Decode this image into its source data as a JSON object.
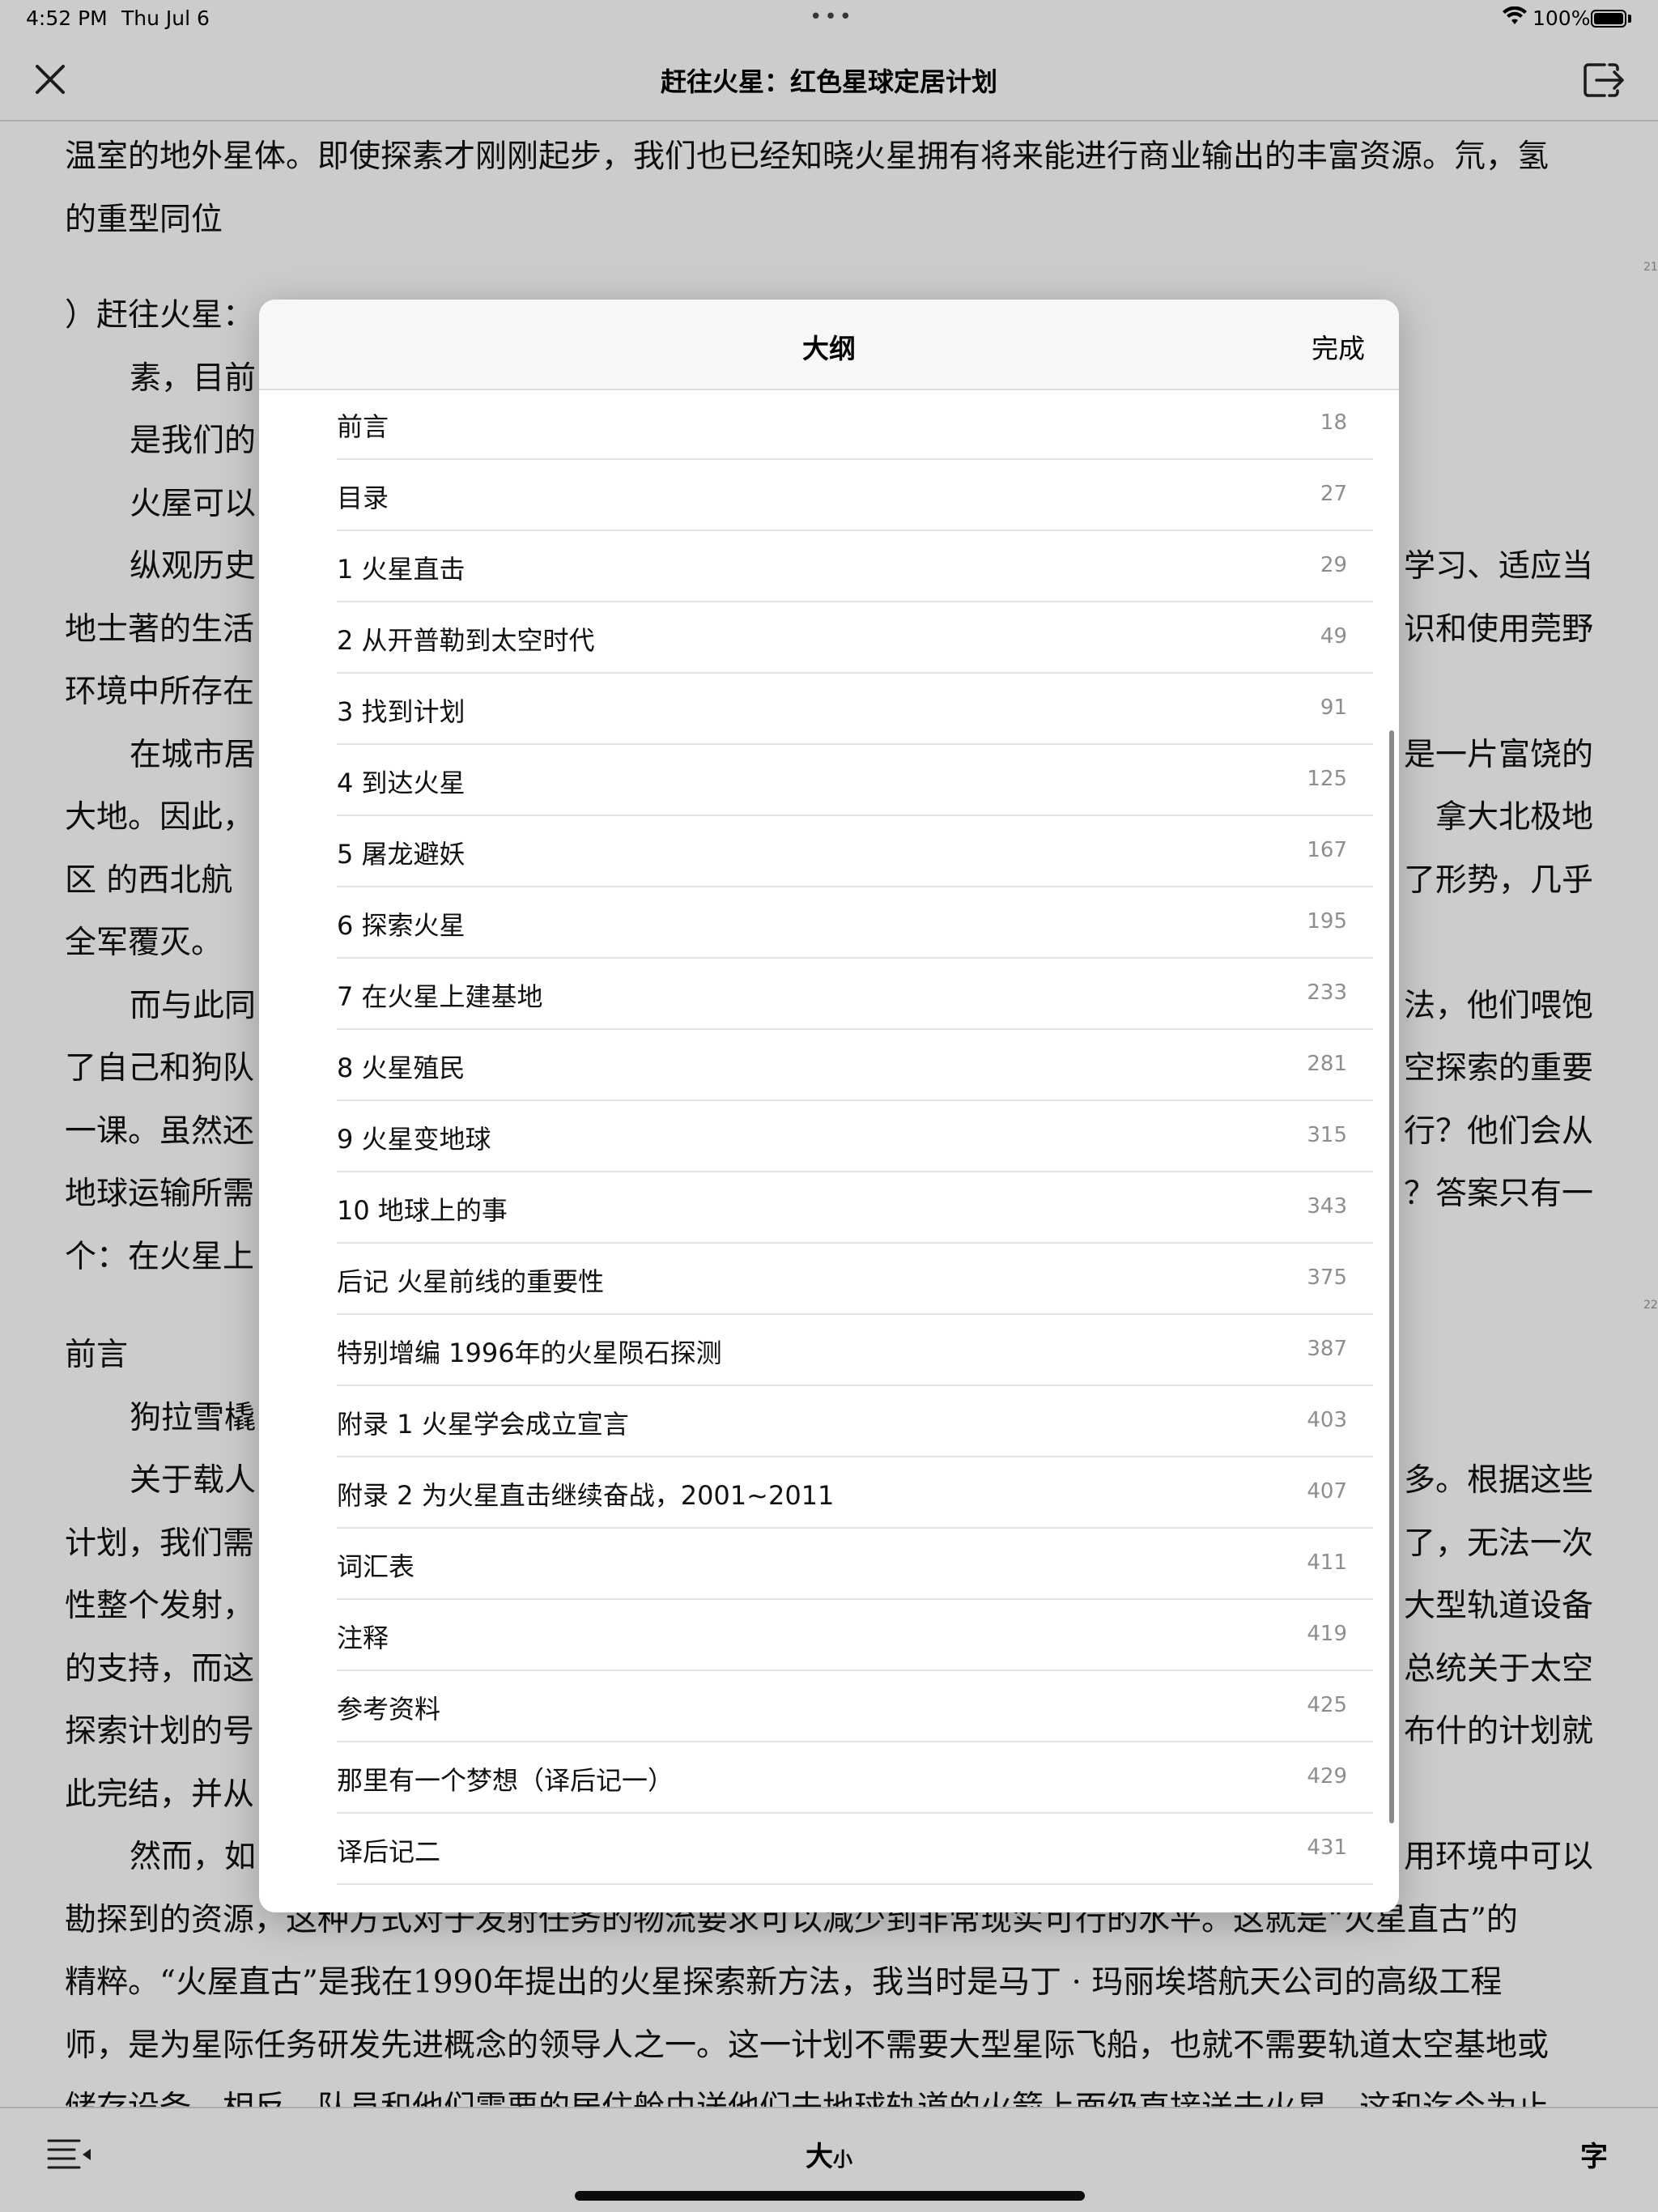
{
  "status_bar": {
    "time": "4:52 PM",
    "date": "Thu Jul 6",
    "battery": "100%",
    "battery_level": 1.0
  },
  "top_bar": {
    "title": "赶往火星：红色星球定居计划",
    "close_icon": "close-icon",
    "exit_icon": "exit-icon"
  },
  "reader": {
    "lines": [
      "温室的地外星体。即使探素才刚刚起步，我们也已经知晓火星拥有将来能进行商业输出的丰富资源。氘，氢",
      "的重型同位",
      "）赶往火星：",
      "素，目前",
      "是我们的",
      "火屋可以",
      "纵观历史",
      "地士著的生活",
      "环境中所存在",
      "在城市居",
      "大地。因此，",
      "区  的西北航",
      "全军覆灭。",
      "而与此同",
      "了自己和狗队",
      "一课。虽然还",
      "地球运输所需",
      "个：在火星上",
      "前言",
      "狗拉雪橇",
      "关于载人",
      "计划，我们需",
      "性整个发射，",
      "的支持，而这",
      "探索计划的号",
      "此完结，并从",
      "然而，如",
      "勘探到的资源，这种方式对于发射任务的物流要求可以减少到非常现实可行的水平。这就是“火星直古”的",
      "精粹。“火屋直古”是我在1990年提出的火星探索新方法，我当时是马丁 · 玛丽埃塔航天公司的高级工程",
      "师，是为星际任务研发先进概念的领导人之一。这一计划不需要大型星际飞船，也就不需要轨道太空基地或",
      "储存设备。相反，队员和他们需要的居住舱由送他们去地球轨道的火箭上面级直接送去火星。这和迄今为止"
    ],
    "right_fragments": [
      "学习、适应当",
      "识和使用莞野",
      "是一片富饶的",
      "拿大北极地",
      "了形势，几乎",
      "法，他们喂饱",
      "空探索的重要",
      "行？他们会从",
      "？答案只有一",
      "多。根据这些",
      "了，无法一次",
      "大型轨道设备",
      "总统关于太空",
      "布什的计划就",
      "用环境中可以"
    ],
    "page_markers": [
      "21",
      "22"
    ]
  },
  "outline": {
    "title": "大纲",
    "done_label": "完成",
    "items": [
      {
        "label": "前言",
        "page": "18"
      },
      {
        "label": "目录",
        "page": "27"
      },
      {
        "label": "1 火星直击",
        "page": "29"
      },
      {
        "label": "2 从开普勒到太空时代",
        "page": "49"
      },
      {
        "label": "3 找到计划",
        "page": "91"
      },
      {
        "label": "4 到达火星",
        "page": "125"
      },
      {
        "label": "5 屠龙避妖",
        "page": "167"
      },
      {
        "label": "6 探索火星",
        "page": "195"
      },
      {
        "label": "7 在火星上建基地",
        "page": "233"
      },
      {
        "label": "8 火星殖民",
        "page": "281"
      },
      {
        "label": "9 火星变地球",
        "page": "315"
      },
      {
        "label": "10 地球上的事",
        "page": "343"
      },
      {
        "label": "后记 火星前线的重要性",
        "page": "375"
      },
      {
        "label": "特别增编 1996年的火星陨石探测",
        "page": "387"
      },
      {
        "label": "附录 1 火星学会成立宣言",
        "page": "403"
      },
      {
        "label": "附录 2 为火星直击继续奋战，2001~2011",
        "page": "407"
      },
      {
        "label": "词汇表",
        "page": "411"
      },
      {
        "label": "注释",
        "page": "419"
      },
      {
        "label": "参考资料",
        "page": "425"
      },
      {
        "label": "那里有一个梦想（译后记一）",
        "page": "429"
      },
      {
        "label": "译后记二",
        "page": "431"
      }
    ]
  },
  "bottom_bar": {
    "size_large": "大",
    "size_small": "小",
    "font_label": "字",
    "toc_icon": "table-of-contents-icon"
  }
}
